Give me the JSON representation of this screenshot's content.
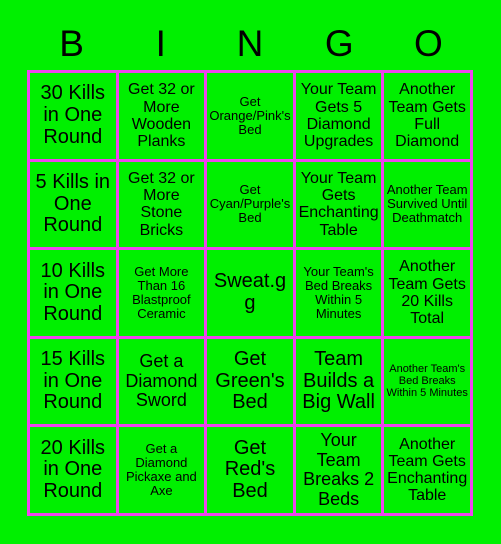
{
  "header": {
    "letters": [
      "B",
      "I",
      "N",
      "G",
      "O"
    ]
  },
  "colors": {
    "background": "#00f000",
    "cell_fill": "#00f000",
    "border": "#ee44ee",
    "text": "#000000"
  },
  "grid": {
    "rows": 5,
    "columns": 5,
    "cells": [
      {
        "text": "30 Kills in One Round",
        "size": "xl"
      },
      {
        "text": "Get 32 or More Wooden Planks",
        "size": "md"
      },
      {
        "text": "Get Orange/Pink's Bed",
        "size": "sm"
      },
      {
        "text": "Your Team Gets 5 Diamond Upgrades",
        "size": "md"
      },
      {
        "text": "Another Team Gets Full Diamond",
        "size": "md"
      },
      {
        "text": "5 Kills in One Round",
        "size": "xl"
      },
      {
        "text": "Get 32 or More Stone Bricks",
        "size": "md"
      },
      {
        "text": "Get Cyan/Purple's Bed",
        "size": "sm"
      },
      {
        "text": "Your Team Gets Enchanting Table",
        "size": "md"
      },
      {
        "text": "Another Team Survived Until Deathmatch",
        "size": "sm"
      },
      {
        "text": "10 Kills in One Round",
        "size": "xl"
      },
      {
        "text": "Get More Than 16 Blastproof Ceramic",
        "size": "sm"
      },
      {
        "text": "Sweat.gg",
        "size": "xl"
      },
      {
        "text": "Your Team's Bed Breaks Within 5 Minutes",
        "size": "sm"
      },
      {
        "text": "Another Team Gets 20 Kills Total",
        "size": "md"
      },
      {
        "text": "15 Kills in One Round",
        "size": "xl"
      },
      {
        "text": "Get a Diamond Sword",
        "size": "lg"
      },
      {
        "text": "Get Green's Bed",
        "size": "xl"
      },
      {
        "text": "Team Builds a Big Wall",
        "size": "xl"
      },
      {
        "text": "Another Team's Bed Breaks Within 5 Minutes",
        "size": "xs"
      },
      {
        "text": "20 Kills in One Round",
        "size": "xl"
      },
      {
        "text": "Get a Diamond Pickaxe and Axe",
        "size": "sm"
      },
      {
        "text": "Get Red's Bed",
        "size": "xl"
      },
      {
        "text": "Your Team Breaks 2 Beds",
        "size": "lg"
      },
      {
        "text": "Another Team Gets Enchanting Table",
        "size": "md"
      }
    ]
  }
}
